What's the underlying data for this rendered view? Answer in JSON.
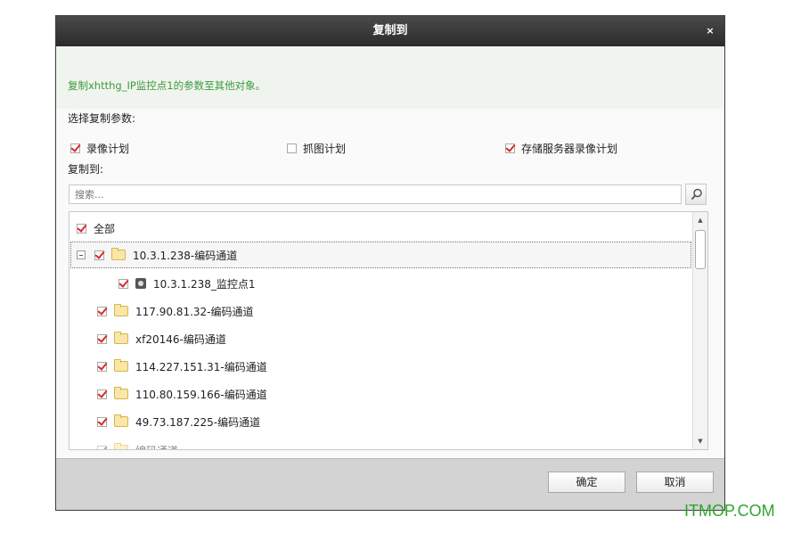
{
  "dialog": {
    "title": "复制到",
    "close_label": "×",
    "info": "复制xhtthg_IP监控点1的参数至其他对象。"
  },
  "params": {
    "heading": "选择复制参数:",
    "options": [
      {
        "label": "录像计划",
        "checked": true
      },
      {
        "label": "抓图计划",
        "checked": false
      },
      {
        "label": "存储服务器录像计划",
        "checked": true
      }
    ]
  },
  "copy_to": {
    "heading": "复制到:",
    "search_placeholder": "搜索..."
  },
  "tree": {
    "all_label": "全部",
    "items": [
      {
        "label": "10.3.1.238-编码通道",
        "type": "folder",
        "expanded": true,
        "checked": true
      },
      {
        "label": "10.3.1.238_监控点1",
        "type": "camera",
        "checked": true
      },
      {
        "label": "117.90.81.32-编码通道",
        "type": "folder",
        "checked": true
      },
      {
        "label": "xf20146-编码通道",
        "type": "folder",
        "checked": true
      },
      {
        "label": "114.227.151.31-编码通道",
        "type": "folder",
        "checked": true
      },
      {
        "label": "110.80.159.166-编码通道",
        "type": "folder",
        "checked": true
      },
      {
        "label": "49.73.187.225-编码通道",
        "type": "folder",
        "checked": true
      },
      {
        "label": "编码通道",
        "type": "folder",
        "checked": true
      }
    ]
  },
  "footer": {
    "ok_label": "确定",
    "cancel_label": "取消"
  },
  "watermark": "ITMOP.COM",
  "colors": {
    "accent_green": "#3c9a3c",
    "check_red": "#d62b2b",
    "titlebar": "#2b2b2b"
  }
}
